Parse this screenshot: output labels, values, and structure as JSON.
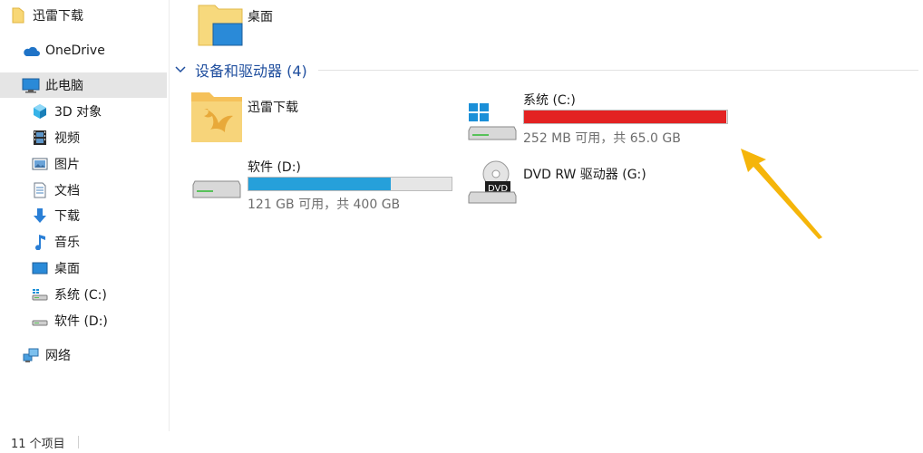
{
  "sidebar": {
    "items": [
      {
        "label": "迅雷下载",
        "icon": "folder-icon"
      },
      {
        "label": "OneDrive",
        "icon": "cloud-icon"
      },
      {
        "label": "此电脑",
        "icon": "computer-icon",
        "selected": true
      },
      {
        "label": "3D 对象",
        "icon": "cube-icon"
      },
      {
        "label": "视频",
        "icon": "film-icon"
      },
      {
        "label": "图片",
        "icon": "picture-icon"
      },
      {
        "label": "文档",
        "icon": "document-icon"
      },
      {
        "label": "下载",
        "icon": "download-arrow-icon"
      },
      {
        "label": "音乐",
        "icon": "music-note-icon"
      },
      {
        "label": "桌面",
        "icon": "desktop-icon"
      },
      {
        "label": "系统 (C:)",
        "icon": "system-drive-icon"
      },
      {
        "label": "软件 (D:)",
        "icon": "drive-icon"
      },
      {
        "label": "网络",
        "icon": "network-icon"
      }
    ]
  },
  "main": {
    "top_folder": {
      "label": "桌面",
      "icon": "desktop-folder-icon"
    },
    "group_title": "设备和驱动器 (4)",
    "devices": [
      {
        "name": "迅雷下载",
        "icon": "xunlei-folder-icon"
      },
      {
        "name": "系统 (C:)",
        "icon": "windows-drive-icon",
        "free_text": "252 MB 可用，共 65.0 GB",
        "usage": 0.996,
        "bar_color": "#e32222"
      },
      {
        "name": "软件 (D:)",
        "icon": "drive-icon",
        "free_text": "121 GB 可用，共 400 GB",
        "usage": 0.7,
        "bar_color": "#26a0da"
      },
      {
        "name": "DVD RW 驱动器 (G:)",
        "icon": "dvd-drive-icon",
        "badge": "DVD"
      }
    ]
  },
  "annotation": {
    "color": "#f5b50a",
    "icon": "arrow-annotation-icon"
  },
  "status": {
    "count": "11 个项目"
  }
}
